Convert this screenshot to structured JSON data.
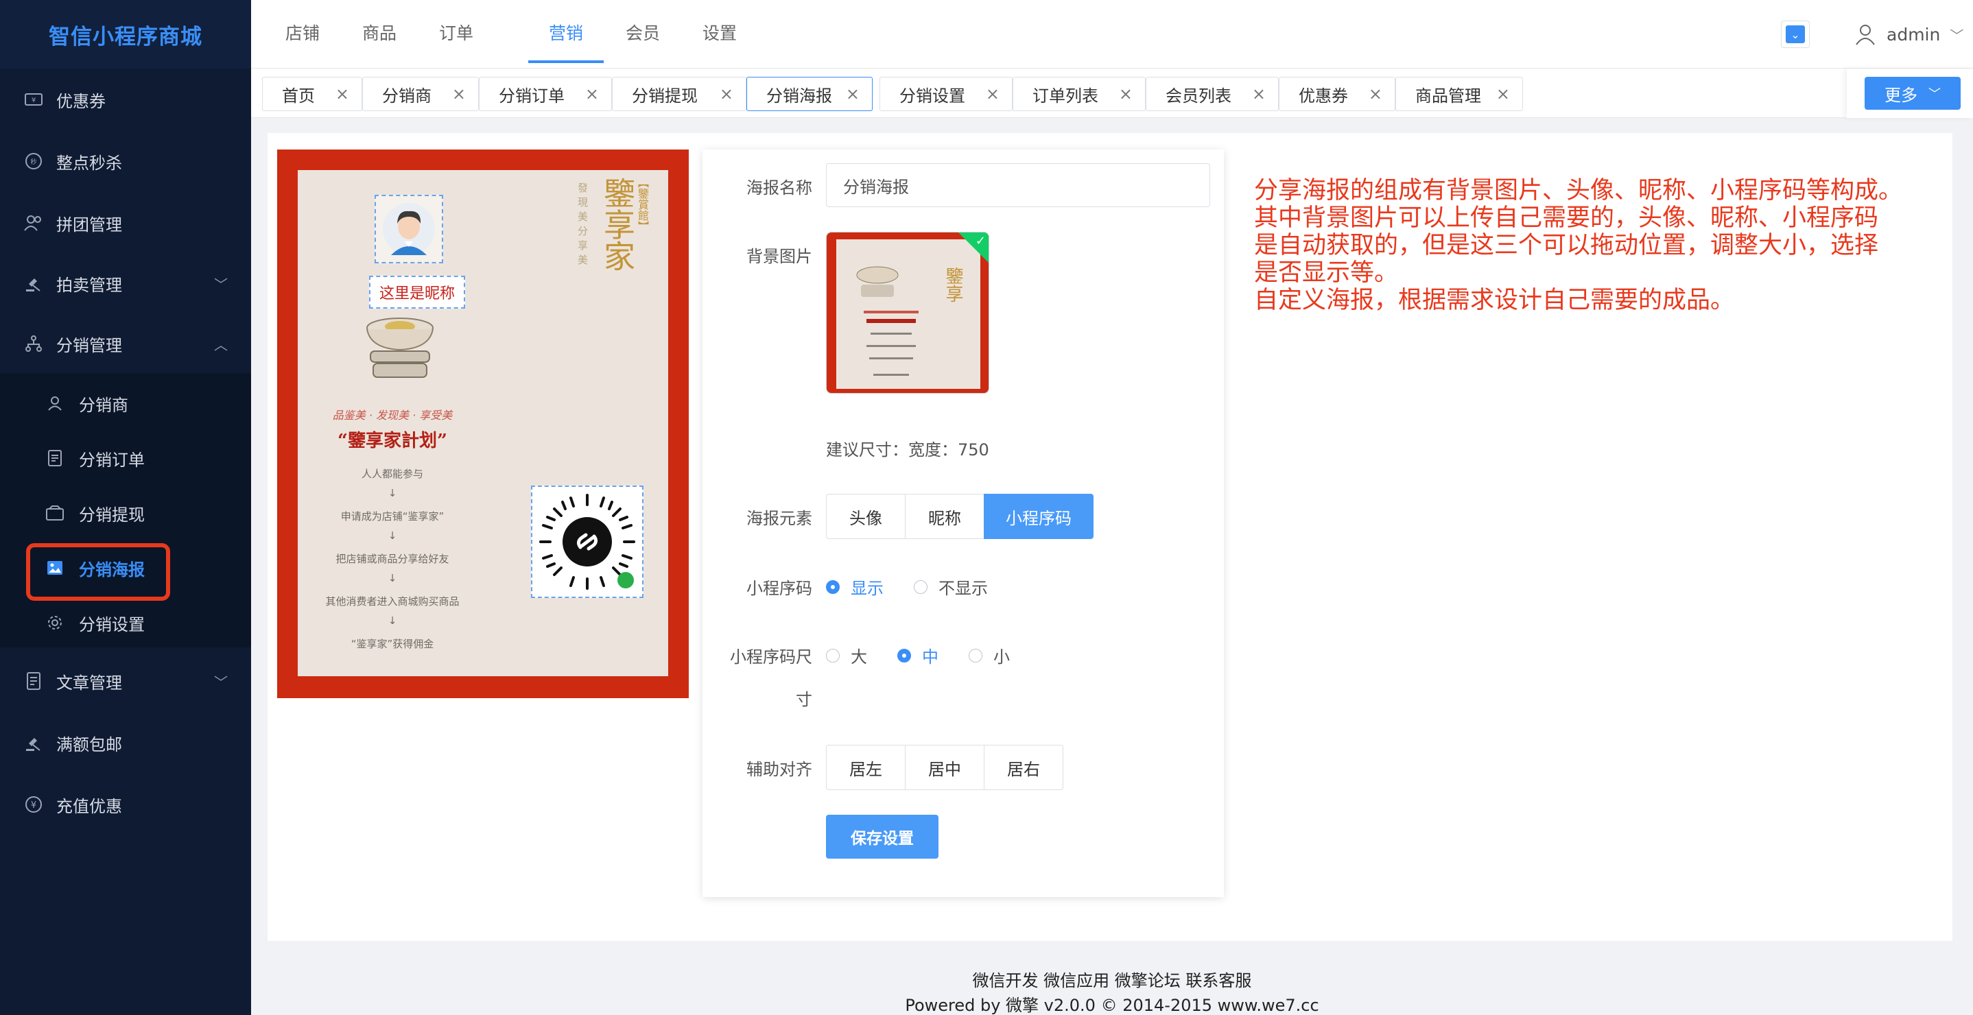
{
  "app": {
    "title": "智信小程序商城"
  },
  "sidebar": {
    "items": [
      {
        "label": "优惠券",
        "icon": "coupon-icon"
      },
      {
        "label": "整点秒杀",
        "icon": "flash-sale-icon"
      },
      {
        "label": "拼团管理",
        "icon": "group-buy-icon"
      },
      {
        "label": "拍卖管理",
        "icon": "auction-icon",
        "arrow": "chevron-down"
      },
      {
        "label": "分销管理",
        "icon": "distribution-icon",
        "arrow": "chevron-up"
      },
      {
        "label": "文章管理",
        "icon": "article-icon",
        "arrow": "chevron-down"
      },
      {
        "label": "满额包邮",
        "icon": "free-shipping-icon"
      },
      {
        "label": "充值优惠",
        "icon": "recharge-icon"
      }
    ],
    "submenu": [
      {
        "label": "分销商",
        "icon": "user-icon"
      },
      {
        "label": "分销订单",
        "icon": "order-icon"
      },
      {
        "label": "分销提现",
        "icon": "withdraw-icon"
      },
      {
        "label": "分销海报",
        "icon": "poster-icon",
        "active": true
      },
      {
        "label": "分销设置",
        "icon": "gear-icon"
      }
    ]
  },
  "topnav": {
    "items": [
      "店铺",
      "商品",
      "订单",
      "营销",
      "会员",
      "设置"
    ],
    "active": "营销",
    "user": "admin"
  },
  "tabs": {
    "items": [
      "首页",
      "分销商",
      "分销订单",
      "分销提现",
      "分销海报",
      "分销设置",
      "订单列表",
      "会员列表",
      "优惠券",
      "商品管理"
    ],
    "active": "分销海报",
    "more_label": "更多"
  },
  "poster": {
    "nickname_placeholder": "这里是昵称",
    "title_vertical": "鑒享家",
    "subtitle_vertical": "發現美分享美",
    "tag_vertical": "【鑒賞館】",
    "slogan": "品鉴美 · 发现美 · 享受美",
    "plan_title": "“鑒享家計划”",
    "steps": [
      "人人都能参与",
      "↓",
      "申请成为店铺“鉴享家”",
      "↓",
      "把店铺或商品分享给好友",
      "↓",
      "其他消费者进入商城购买商品",
      "↓",
      "“鉴享家”获得佣金"
    ]
  },
  "form": {
    "name_label": "海报名称",
    "name_value": "分销海报",
    "bg_label": "背景图片",
    "size_hint": "建议尺寸：宽度：750",
    "elements_label": "海报元素",
    "elements": [
      "头像",
      "昵称",
      "小程序码"
    ],
    "elements_active": "小程序码",
    "qr_label": "小程序码",
    "qr_show_options": [
      "显示",
      "不显示"
    ],
    "qr_show_selected": "显示",
    "qr_size_label_line1": "小程序码尺",
    "qr_size_label_line2": "寸",
    "qr_size_options": [
      "大",
      "中",
      "小"
    ],
    "qr_size_selected": "中",
    "align_label": "辅助对齐",
    "align_options": [
      "居左",
      "居中",
      "居右"
    ],
    "save_label": "保存设置"
  },
  "annotation": {
    "lines": [
      "分享海报的组成有背景图片、头像、昵称、小程序码等构成。",
      "其中背景图片可以上传自己需要的，头像、昵称、小程序码",
      "是自动获取的，但是这三个可以拖动位置，调整大小，选择",
      "是否显示等。",
      "自定义海报，根据需求设计自己需要的成品。"
    ]
  },
  "footer": {
    "links": "微信开发 微信应用 微擎论坛 联系客服",
    "copyright": "Powered by 微擎 v2.0.0 © 2014-2015 www.we7.cc"
  },
  "colors": {
    "accent": "#3a8ef6",
    "sidebar_bg": "#0f1b33",
    "poster_red": "#cc2b12",
    "annotation": "#e8391d"
  }
}
